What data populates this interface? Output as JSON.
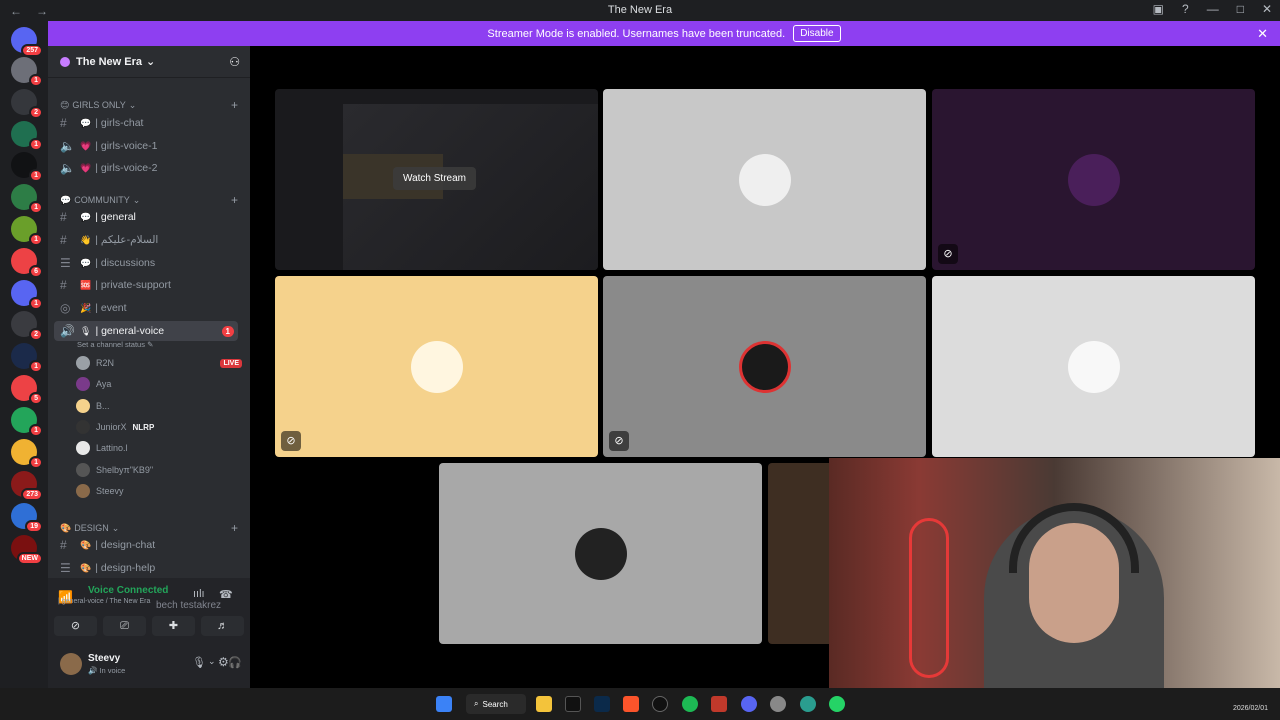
{
  "window": {
    "title": "The New Era",
    "back": "←",
    "forward": "→"
  },
  "banner": {
    "text": "Streamer Mode is enabled. Usernames have been truncated.",
    "disable": "Disable",
    "close": "✕"
  },
  "guilds": [
    {
      "badge": "257",
      "color": "#5865f2"
    },
    {
      "badge": "1",
      "color": "#6d6f78"
    },
    {
      "badge": "2",
      "color": "#35373c"
    },
    {
      "badge": "1",
      "color": "#1f6f50"
    },
    {
      "badge": "1",
      "color": "#111214"
    },
    {
      "badge": "1",
      "color": "#2d7d46"
    },
    {
      "badge": "1",
      "color": "#6a9f2a"
    },
    {
      "badge": "6",
      "color": "#ed4245"
    },
    {
      "badge": "1",
      "color": "#5865f2"
    },
    {
      "badge": "2",
      "color": "#3a3b40"
    },
    {
      "badge": "1",
      "color": "#1b2a4a"
    },
    {
      "badge": "5",
      "color": "#ed4245"
    },
    {
      "badge": "1",
      "color": "#23a55a"
    },
    {
      "badge": "1",
      "color": "#f0b232"
    },
    {
      "badge": "273",
      "color": "#8b1a1a"
    },
    {
      "badge": "19",
      "color": "#2f6fd6"
    },
    {
      "badge": "NEW",
      "color": "#7a1010"
    }
  ],
  "server": {
    "name": "The New Era"
  },
  "categories": {
    "girls": "GIRLS ONLY",
    "community": "COMMUNITY",
    "design": "DESIGN"
  },
  "channels": {
    "girls_chat": "| girls-chat",
    "girls_voice_1": "| girls-voice-1",
    "girls_voice_2": "| girls-voice-2",
    "general": "| general",
    "salam": "| السلام-عليكم",
    "discussions": "| discussions",
    "private_support": "| private-support",
    "event": "| event",
    "general_voice": "| general-voice",
    "general_voice_badge": "1",
    "channel_status": "Set a channel status",
    "design_chat": "| design-chat",
    "design_help": "| design-help"
  },
  "voice_users": [
    {
      "name": "R2N",
      "tag": "LIVE",
      "color": "#9aa0a6"
    },
    {
      "name": "Aya",
      "tag": "",
      "color": "#7a3a8a"
    },
    {
      "name": "B...",
      "tag": "",
      "color": "#f5d28c"
    },
    {
      "name": "JuniorX",
      "tag": "NLRP",
      "color": "#333"
    },
    {
      "name": "Lattino.l",
      "tag": "",
      "color": "#e8e8e8"
    },
    {
      "name": "Shelbyπ\"KB9\"",
      "tag": "",
      "color": "#555"
    },
    {
      "name": "Steevy",
      "tag": "",
      "color": "#8a6a4a"
    }
  ],
  "voice_panel": {
    "status": "Voice Connected",
    "location": "| general-voice / The New Era",
    "overlay_name": "bech testakrez"
  },
  "user_panel": {
    "name": "Steevy",
    "status": "In voice"
  },
  "stream": {
    "watch_label": "Watch Stream"
  },
  "tiles": [
    {
      "color": "#1a1a1d"
    },
    {
      "color": "#c8c8c8"
    },
    {
      "color": "#2a1530"
    },
    {
      "color": "#f5d28c"
    },
    {
      "color": "#8a8a8a"
    },
    {
      "color": "#dcdcdc"
    },
    {
      "color": "#a8a8a8"
    },
    {
      "color": "#3e2e22"
    }
  ],
  "taskbar": {
    "search": "Search",
    "date": "2026/02/01"
  },
  "colors": {
    "accent": "#5865f2",
    "banner": "#8e3ff1",
    "voice_green": "#23a55a",
    "mention_red": "#f23f43"
  }
}
